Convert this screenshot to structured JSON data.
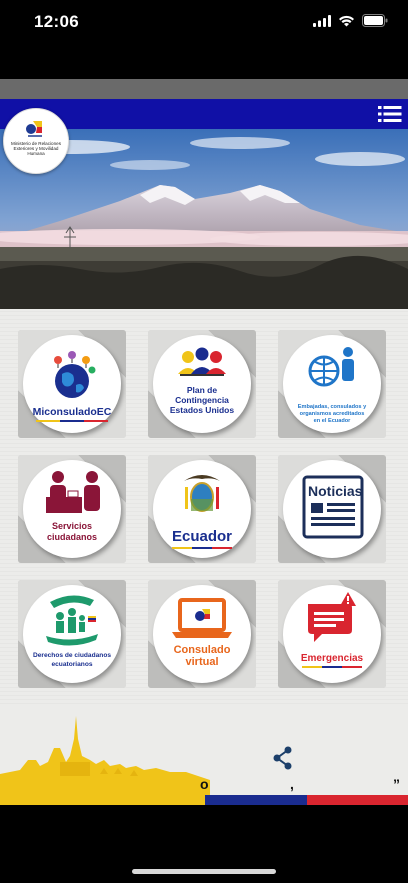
{
  "status": {
    "time": "12:06"
  },
  "header": {
    "logo_text": "Ministerio de Relaciones Exteriores y Movilidad Humana"
  },
  "tiles": [
    {
      "label": "MiconsuladoEC"
    },
    {
      "label_lines": [
        "Plan de",
        "Contingencia",
        "Estados Unidos"
      ]
    },
    {
      "label_lines": [
        "Embajadas, consulados y",
        "organismos acreditados",
        "en el Ecuador"
      ]
    },
    {
      "label_lines": [
        "Servicios",
        "ciudadanos"
      ]
    },
    {
      "label": "Ecuador"
    },
    {
      "label": "Noticias"
    },
    {
      "label_lines": [
        "Derechos de ciudadanos",
        "ecuatorianos"
      ]
    },
    {
      "label_lines": [
        "Consulado",
        "virtual"
      ]
    },
    {
      "label": "Emergencias"
    }
  ],
  "footer": {
    "marks": [
      "o",
      ",",
      "”"
    ]
  },
  "colors": {
    "blue_bar": "#1010a6",
    "flag_yellow": "#f0c419",
    "flag_blue": "#1a2c8f",
    "flag_red": "#d9252f",
    "accent_red": "#c8102e"
  },
  "icons": [
    "wifi-icon",
    "signal-icon",
    "battery-icon",
    "menu-icon",
    "share-icon"
  ]
}
